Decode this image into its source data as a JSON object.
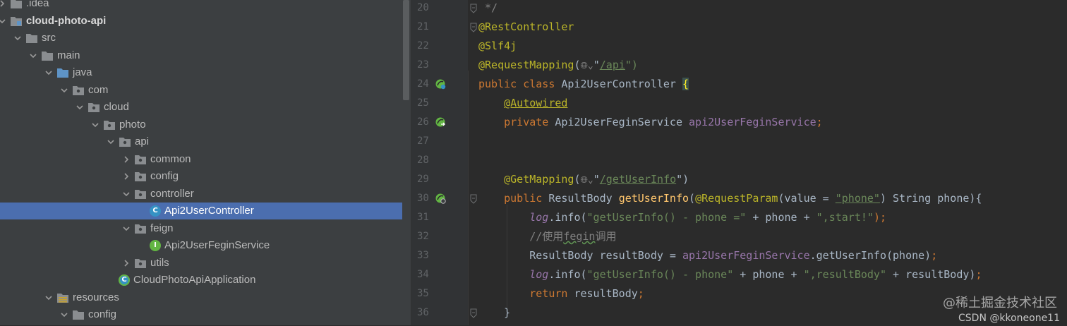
{
  "project_tree": {
    "items": [
      {
        "label": ".idea",
        "depth": 0,
        "expanded": false,
        "kind": "folder-gray"
      },
      {
        "label": "cloud-photo-api",
        "depth": 0,
        "expanded": true,
        "kind": "module",
        "bold": true
      },
      {
        "label": "src",
        "depth": 1,
        "expanded": true,
        "kind": "folder-gray"
      },
      {
        "label": "main",
        "depth": 2,
        "expanded": true,
        "kind": "folder-gray"
      },
      {
        "label": "java",
        "depth": 3,
        "expanded": true,
        "kind": "folder-blue"
      },
      {
        "label": "com",
        "depth": 4,
        "expanded": true,
        "kind": "package"
      },
      {
        "label": "cloud",
        "depth": 5,
        "expanded": true,
        "kind": "package"
      },
      {
        "label": "photo",
        "depth": 6,
        "expanded": true,
        "kind": "package"
      },
      {
        "label": "api",
        "depth": 7,
        "expanded": true,
        "kind": "package"
      },
      {
        "label": "common",
        "depth": 8,
        "expanded": false,
        "kind": "package"
      },
      {
        "label": "config",
        "depth": 8,
        "expanded": false,
        "kind": "package"
      },
      {
        "label": "controller",
        "depth": 8,
        "expanded": true,
        "kind": "package"
      },
      {
        "label": "Api2UserController",
        "depth": 9,
        "kind": "class",
        "selected": true
      },
      {
        "label": "feign",
        "depth": 8,
        "expanded": true,
        "kind": "package"
      },
      {
        "label": "Api2UserFeginService",
        "depth": 9,
        "kind": "interface"
      },
      {
        "label": "utils",
        "depth": 8,
        "expanded": false,
        "kind": "package"
      },
      {
        "label": "CloudPhotoApiApplication",
        "depth": 7,
        "kind": "spring-app"
      },
      {
        "label": "resources",
        "depth": 3,
        "expanded": true,
        "kind": "folder-resources"
      },
      {
        "label": "config",
        "depth": 4,
        "expanded": true,
        "kind": "folder-gray"
      }
    ]
  },
  "editor": {
    "lines": [
      {
        "num": "20",
        "code": [
          {
            "t": " */",
            "c": "cmt"
          }
        ],
        "fold": true
      },
      {
        "num": "21",
        "code": [
          {
            "t": "@RestController",
            "c": "ann"
          }
        ],
        "fold": true
      },
      {
        "num": "22",
        "code": [
          {
            "t": "@Slf4j",
            "c": "ann"
          }
        ]
      },
      {
        "num": "23",
        "code": [
          {
            "t": "@RequestMapping",
            "c": "ann"
          },
          {
            "t": "("
          },
          {
            "t": "🌐︎⌄",
            "c": "globe"
          },
          {
            "t": "\""
          },
          {
            "t": "/api",
            "c": "str ul"
          },
          {
            "t": "\")",
            "c": "str"
          }
        ]
      },
      {
        "num": "24",
        "code": [
          {
            "t": "public class ",
            "c": "kw"
          },
          {
            "t": "Api2UserController "
          },
          {
            "t": "{",
            "c": "brace"
          }
        ],
        "gutter_icon": "spring-bean"
      },
      {
        "num": "25",
        "code": [
          {
            "t": "    "
          },
          {
            "t": "@Autowired",
            "c": "ann ul"
          }
        ]
      },
      {
        "num": "26",
        "code": [
          {
            "t": "    "
          },
          {
            "t": "private ",
            "c": "kw"
          },
          {
            "t": "Api2UserFeginService "
          },
          {
            "t": "api2UserFeginService",
            "c": "fld"
          },
          {
            "t": ";",
            "c": "kw"
          }
        ],
        "gutter_icon": "spring-autowire"
      },
      {
        "num": "27",
        "code": []
      },
      {
        "num": "28",
        "code": []
      },
      {
        "num": "29",
        "code": [
          {
            "t": "    "
          },
          {
            "t": "@GetMapping",
            "c": "ann"
          },
          {
            "t": "("
          },
          {
            "t": "🌐︎⌄",
            "c": "globe"
          },
          {
            "t": "\""
          },
          {
            "t": "/getUserInfo",
            "c": "str ul"
          },
          {
            "t": "\")"
          }
        ]
      },
      {
        "num": "30",
        "code": [
          {
            "t": "    "
          },
          {
            "t": "public ",
            "c": "kw"
          },
          {
            "t": "ResultBody "
          },
          {
            "t": "getUserInfo",
            "c": "mth"
          },
          {
            "t": "("
          },
          {
            "t": "@RequestParam",
            "c": "ann"
          },
          {
            "t": "(value = "
          },
          {
            "t": "\"phone\"",
            "c": "str ul"
          },
          {
            "t": ") String phone){"
          }
        ],
        "gutter_icon": "spring-web",
        "fold": true
      },
      {
        "num": "31",
        "code": [
          {
            "t": "        "
          },
          {
            "t": "log",
            "c": "log"
          },
          {
            "t": ".info("
          },
          {
            "t": "\"getUserInfo() - phone =\"",
            "c": "str"
          },
          {
            "t": " + phone + "
          },
          {
            "t": "\",start!\"",
            "c": "str"
          },
          {
            "t": ");",
            "c": "kw"
          }
        ]
      },
      {
        "num": "32",
        "code": [
          {
            "t": "        "
          },
          {
            "t": "//使用",
            "c": "cmt"
          },
          {
            "t": "fegin",
            "c": "cmt wavy"
          },
          {
            "t": "调用",
            "c": "cmt"
          }
        ]
      },
      {
        "num": "33",
        "code": [
          {
            "t": "        "
          },
          {
            "t": "ResultBody resultBody = "
          },
          {
            "t": "api2UserFeginService",
            "c": "fld"
          },
          {
            "t": ".getUserInfo(phone)"
          },
          {
            "t": ";",
            "c": "kw"
          }
        ]
      },
      {
        "num": "34",
        "code": [
          {
            "t": "        "
          },
          {
            "t": "log",
            "c": "log"
          },
          {
            "t": ".info("
          },
          {
            "t": "\"getUserInfo() - phone\"",
            "c": "str"
          },
          {
            "t": " + phone + "
          },
          {
            "t": "\",resultBody\"",
            "c": "str"
          },
          {
            "t": " + resultBody)"
          },
          {
            "t": ";",
            "c": "kw"
          }
        ]
      },
      {
        "num": "35",
        "code": [
          {
            "t": "        "
          },
          {
            "t": "return ",
            "c": "kw"
          },
          {
            "t": "resultBody"
          },
          {
            "t": ";",
            "c": "kw"
          }
        ]
      },
      {
        "num": "36",
        "code": [
          {
            "t": "    }"
          }
        ],
        "fold": true
      }
    ]
  },
  "watermark": {
    "main": "@稀土掘金技术社区",
    "sub": "CSDN @kkoneone11"
  },
  "colors": {
    "tree_bg": "#3c3f41",
    "editor_bg": "#2b2b2b",
    "selection": "#4b6eaf",
    "annotation": "#bbb529",
    "keyword": "#cc7832",
    "string": "#6a8759"
  }
}
